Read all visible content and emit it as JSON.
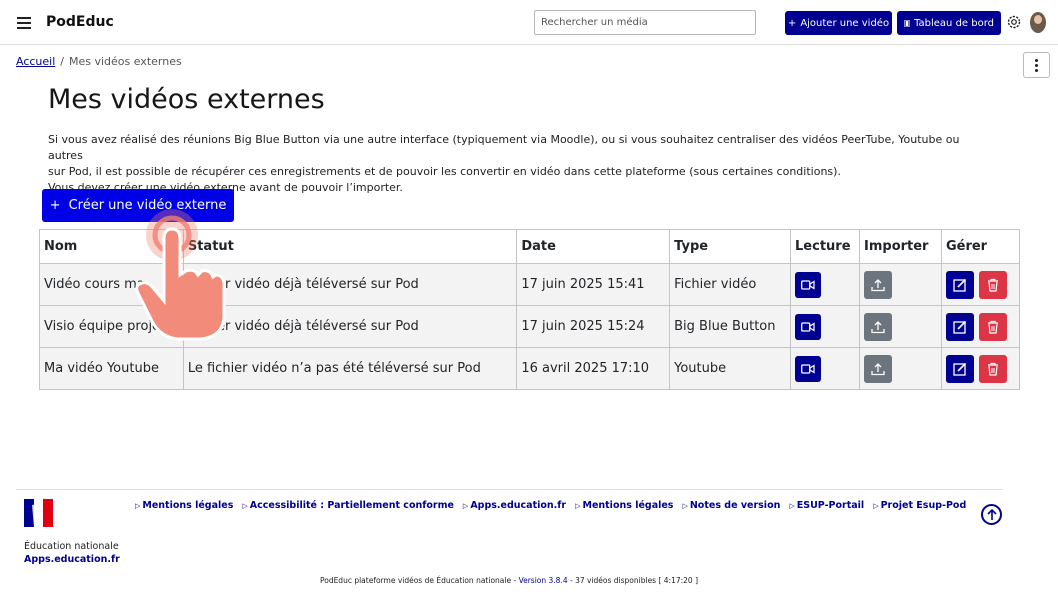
{
  "header": {
    "brand": "PodEduc",
    "search_placeholder": "Rechercher un média",
    "add_video": "Ajouter une vidéo",
    "dashboard": "Tableau de bord"
  },
  "breadcrumb": {
    "home": "Accueil",
    "separator": "/",
    "current": "Mes vidéos externes"
  },
  "page": {
    "title": "Mes vidéos externes",
    "intro_line1": "Si vous avez réalisé des réunions Big Blue Button via une autre interface (typiquement via Moodle), ou si vous souhaitez centraliser des vidéos PeerTube, Youtube ou autres",
    "intro_line2": "sur Pod, il est possible de récupérer ces enregistrements et de pouvoir les convertir en vidéo dans cette plateforme (sous certaines conditions).",
    "intro_line3": "Vous devez créer une vidéo externe avant de pouvoir l’importer.",
    "create_button": "Créer une vidéo externe"
  },
  "table": {
    "headers": {
      "nom": "Nom",
      "statut": "Statut",
      "date": "Date",
      "type": "Type",
      "lecture": "Lecture",
      "importer": "Importer",
      "gerer": "Gérer"
    },
    "rows": [
      {
        "nom": "Vidéo cours ma",
        "statut": "Fichier vidéo déjà téléversé sur Pod",
        "date": "17 juin 2025 15:41",
        "type": "Fichier vidéo"
      },
      {
        "nom": "Visio équipe proje",
        "statut": "Fichier vidéo déjà téléversé sur Pod",
        "date": "17 juin 2025 15:24",
        "type": "Big Blue Button"
      },
      {
        "nom": "Ma vidéo Youtube",
        "statut": "Le fichier vidéo n’a pas été téléversé sur Pod",
        "date": "16 avril 2025 17:10",
        "type": "Youtube"
      }
    ]
  },
  "footer": {
    "links": [
      "Mentions légales",
      "Accessibilité : Partiellement conforme",
      "Apps.education.fr",
      "Mentions légales",
      "Notes de version",
      "ESUP-Portail",
      "Projet Esup-Pod"
    ],
    "org_name": "Éducation nationale",
    "org_site": "Apps.education.fr",
    "bottom_prefix": "PodEduc plateforme vidéos de Éducation nationale - ",
    "version": "Version 3.8.4",
    "bottom_suffix": " - 37 vidéos disponibles [ 4:17:20 ]"
  },
  "colors": {
    "primary_navy": "#000091",
    "create_blue": "#0000e6",
    "import_gray": "#6c757d",
    "delete_red": "#dc3545",
    "touch_overlay": "#f08070"
  },
  "icons": [
    "hamburger-icon",
    "plus-icon",
    "film-icon",
    "gear-icon",
    "avatar",
    "kebab-icon",
    "video-camera-icon",
    "upload-icon",
    "edit-icon",
    "trash-icon",
    "marianne-flag-icon",
    "arrow-up-icon",
    "tap-hand-icon"
  ]
}
